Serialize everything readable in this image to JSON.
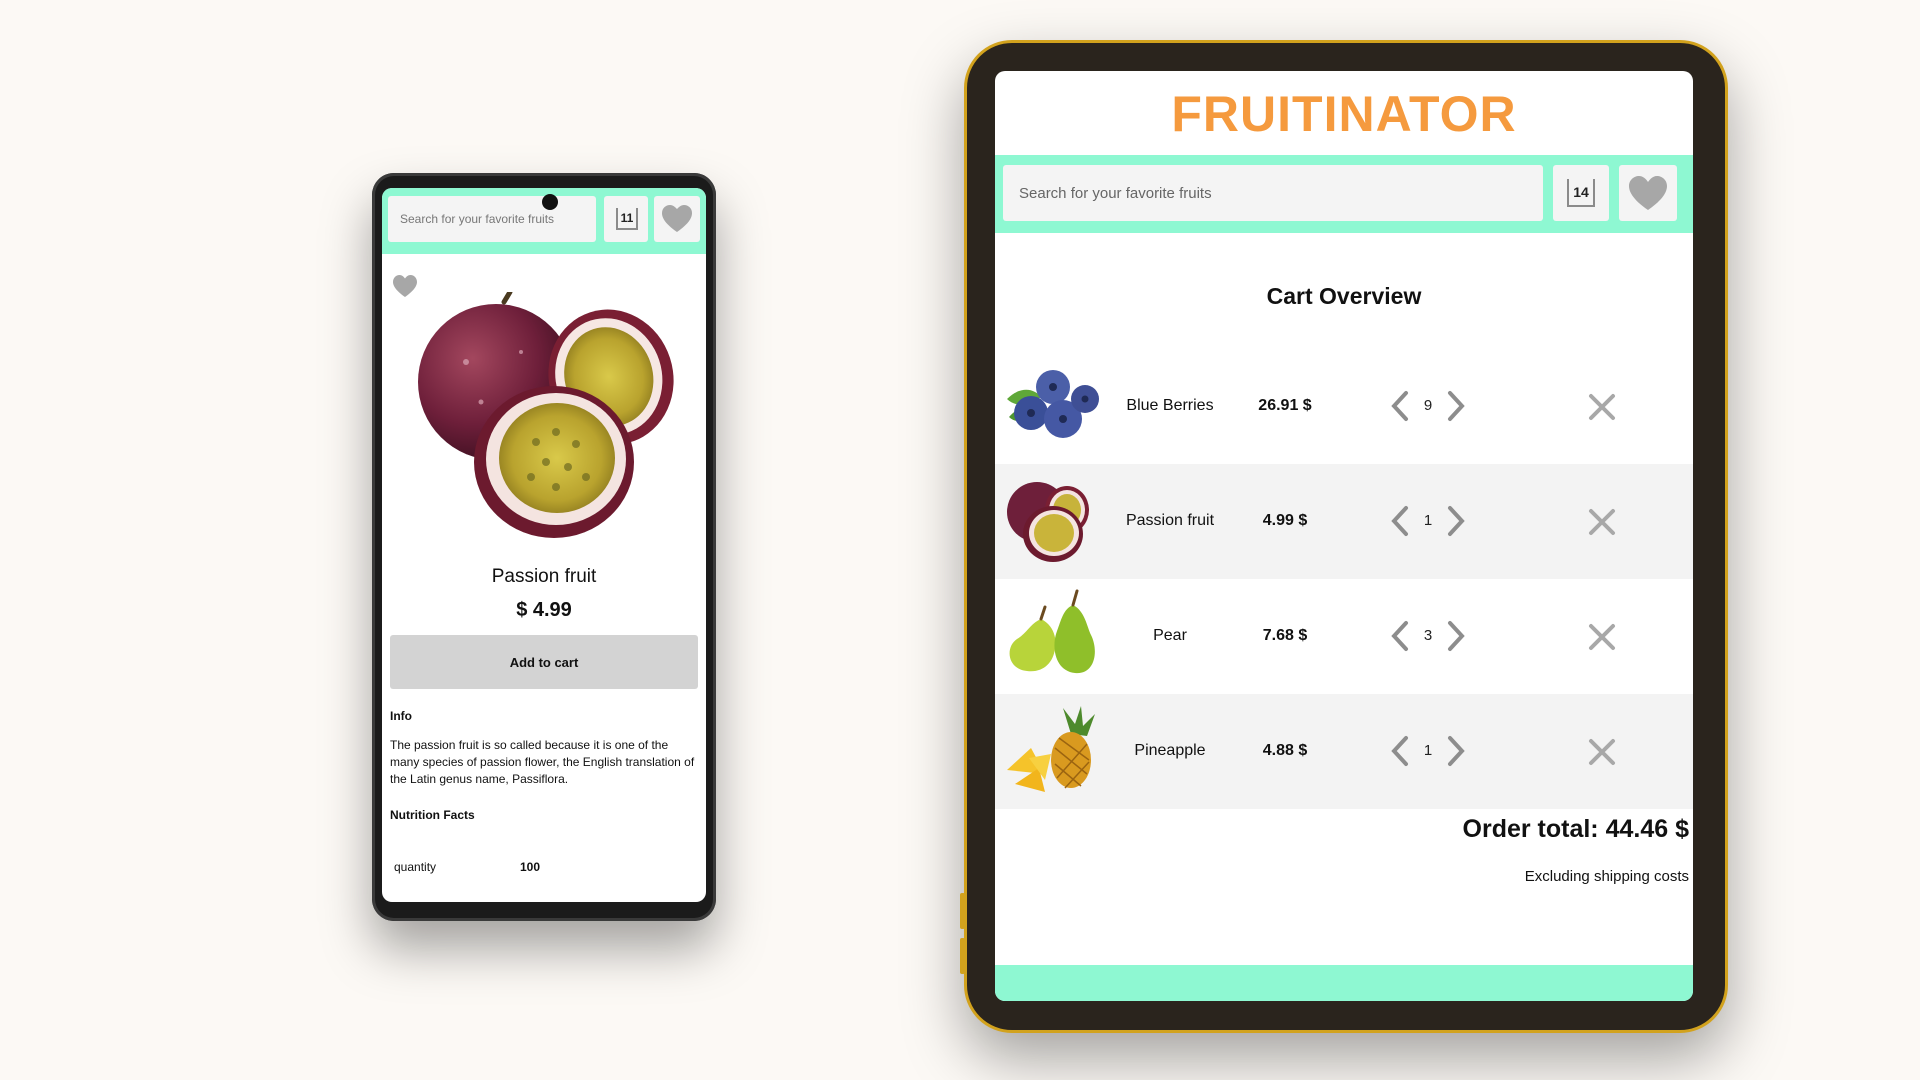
{
  "phone": {
    "search": {
      "placeholder": "Search for your favorite fruits"
    },
    "cart_count": "11",
    "product": {
      "name": "Passion fruit",
      "price": "$ 4.99",
      "add_to_cart_label": "Add to cart",
      "info_title": "Info",
      "info_text": "The passion fruit is so called because it is one of the many species of passion flower, the English translation of the Latin genus name, Passiflora.",
      "nutrition_title": "Nutrition Facts",
      "nutrition": [
        {
          "label": "quantity",
          "value": "100"
        }
      ]
    }
  },
  "tablet": {
    "logo": "FRUITINATOR",
    "search": {
      "placeholder": "Search for your favorite fruits"
    },
    "cart_count": "14",
    "cart": {
      "title": "Cart Overview",
      "items": [
        {
          "name": "Blue Berries",
          "price": "26.91 $",
          "qty": "9",
          "image": "blueberries-image"
        },
        {
          "name": "Passion fruit",
          "price": "4.99 $",
          "qty": "1",
          "image": "passion-fruit-image"
        },
        {
          "name": "Pear",
          "price": "7.68 $",
          "qty": "3",
          "image": "pear-image"
        },
        {
          "name": "Pineapple",
          "price": "4.88 $",
          "qty": "1",
          "image": "pineapple-image"
        }
      ],
      "total": "Order total: 44.46 $",
      "shipping_note": "Excluding shipping costs"
    }
  },
  "colors": {
    "page_bg": "#fcf9f5",
    "accent_mint": "#8ef8d2",
    "logo_orange": "#f59a3e",
    "button_grey": "#d3d3d3",
    "tablet_frame_gold": "#d2a21d",
    "icon_grey": "#a7a7a7"
  },
  "icons": [
    "heart-icon",
    "cart-icon",
    "chevron-left-icon",
    "chevron-right-icon",
    "close-icon"
  ]
}
